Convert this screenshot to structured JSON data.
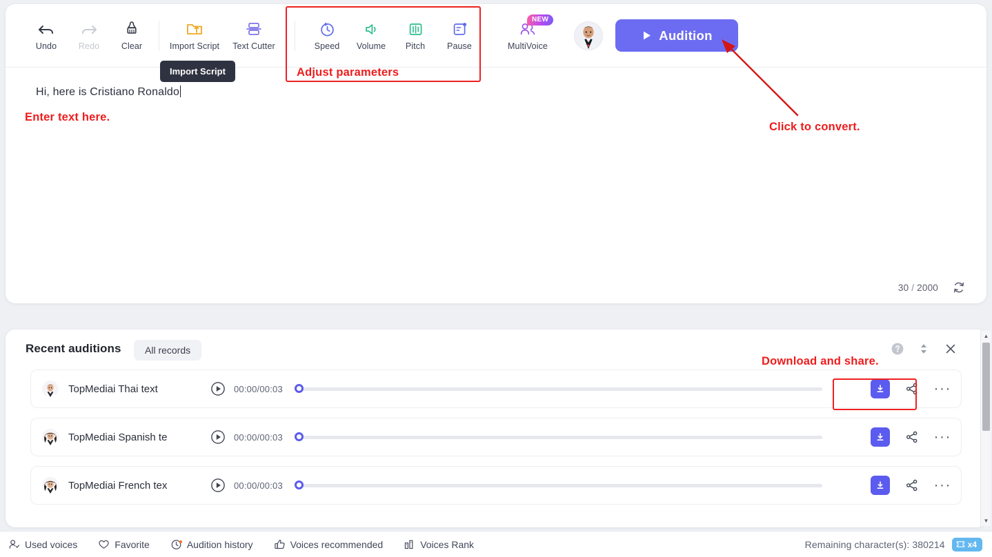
{
  "toolbar": {
    "undo": "Undo",
    "redo": "Redo",
    "clear": "Clear",
    "import_script": "Import Script",
    "text_cutter": "Text Cutter",
    "speed": "Speed",
    "volume": "Volume",
    "pitch": "Pitch",
    "pause": "Pause",
    "multivoice": "MultiVoice",
    "multivoice_badge": "NEW",
    "audition_button": "Audition",
    "tooltip": "Import Script",
    "accent_color": "#6c6cf2"
  },
  "editor": {
    "script_text": "Hi, here is Cristiano Ronaldo",
    "char_count": "30",
    "char_separator": "/",
    "char_limit": "2000",
    "refresh_icon": "refresh-icon"
  },
  "annotations": {
    "adjust_parameters": "Adjust parameters",
    "enter_text_here": "Enter text here.",
    "click_to_convert": "Click to convert.",
    "download_and_share": "Download and share.",
    "color": "#ee1c1c"
  },
  "auditions": {
    "title": "Recent auditions",
    "all_records": "All records",
    "help_icon": "help-circle-icon",
    "sort_icon": "sort-updown-icon",
    "close_icon": "close-icon",
    "rows": [
      {
        "name": "TopMediai Thai text",
        "time": "00:00/00:03",
        "progress": 0
      },
      {
        "name": "TopMediai Spanish te",
        "time": "00:00/00:03",
        "progress": 0
      },
      {
        "name": "TopMediai French tex",
        "time": "00:00/00:03",
        "progress": 0
      }
    ],
    "row_actions": {
      "download": "download-icon",
      "share": "share-icon",
      "more": "more-options-icon"
    }
  },
  "statusbar": {
    "items": [
      {
        "label": "Used voices",
        "icon": "used-voices-icon"
      },
      {
        "label": "Favorite",
        "icon": "heart-icon"
      },
      {
        "label": "Audition history",
        "icon": "clock-icon"
      },
      {
        "label": "Voices recommended",
        "icon": "thumbs-up-icon"
      },
      {
        "label": "Voices Rank",
        "icon": "bar-chart-icon"
      }
    ],
    "remaining": "Remaining character(s): 380214",
    "multiplier": "x4"
  }
}
